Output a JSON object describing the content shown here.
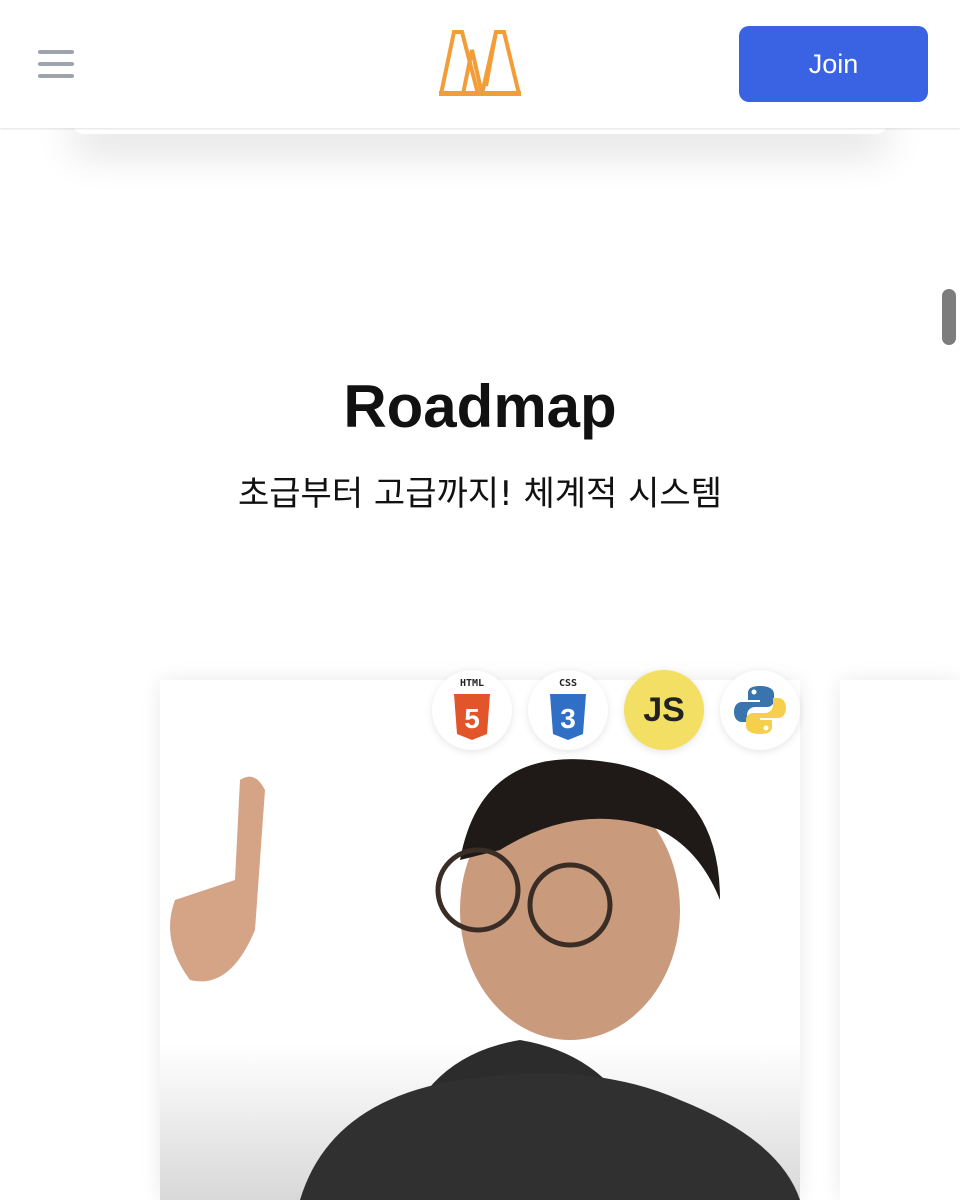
{
  "header": {
    "join_label": "Join",
    "logo_color": "#f29d38",
    "accent": "#3963e3"
  },
  "section": {
    "title": "Roadmap",
    "subtitle": "초급부터 고급까지! 체계적 시스템"
  },
  "badges": [
    {
      "icon": "html5-icon",
      "label": "HTML",
      "digit": "5"
    },
    {
      "icon": "css3-icon",
      "label": "CSS",
      "digit": "3"
    },
    {
      "icon": "javascript-icon",
      "label": "JS"
    },
    {
      "icon": "python-icon"
    }
  ]
}
